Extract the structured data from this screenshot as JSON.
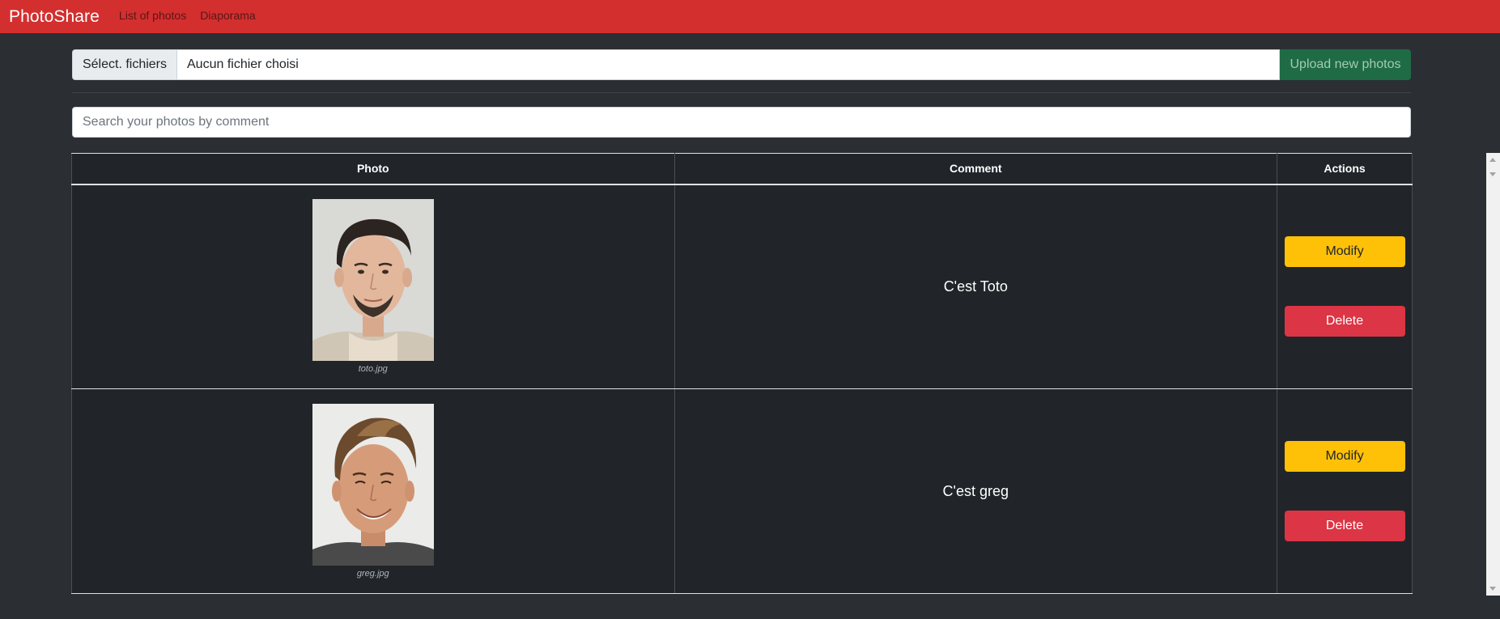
{
  "navbar": {
    "brand": "PhotoShare",
    "links": [
      "List of photos",
      "Diaporama"
    ]
  },
  "upload": {
    "file_button_label": "Sélect. fichiers",
    "file_status": "Aucun fichier choisi",
    "upload_button_label": "Upload new photos"
  },
  "search": {
    "placeholder": "Search your photos by comment"
  },
  "table": {
    "headers": [
      "Photo",
      "Comment",
      "Actions"
    ],
    "rows": [
      {
        "filename": "toto.jpg",
        "comment": "C'est Toto",
        "modify_label": "Modify",
        "delete_label": "Delete"
      },
      {
        "filename": "greg.jpg",
        "comment": "C'est greg",
        "modify_label": "Modify",
        "delete_label": "Delete"
      }
    ]
  },
  "colors": {
    "navbar": "#d32f2f",
    "upload_button": "#1f6b46",
    "modify_button": "#ffc107",
    "delete_button": "#dc3545",
    "background": "#2b2f33",
    "table": "#212529"
  }
}
